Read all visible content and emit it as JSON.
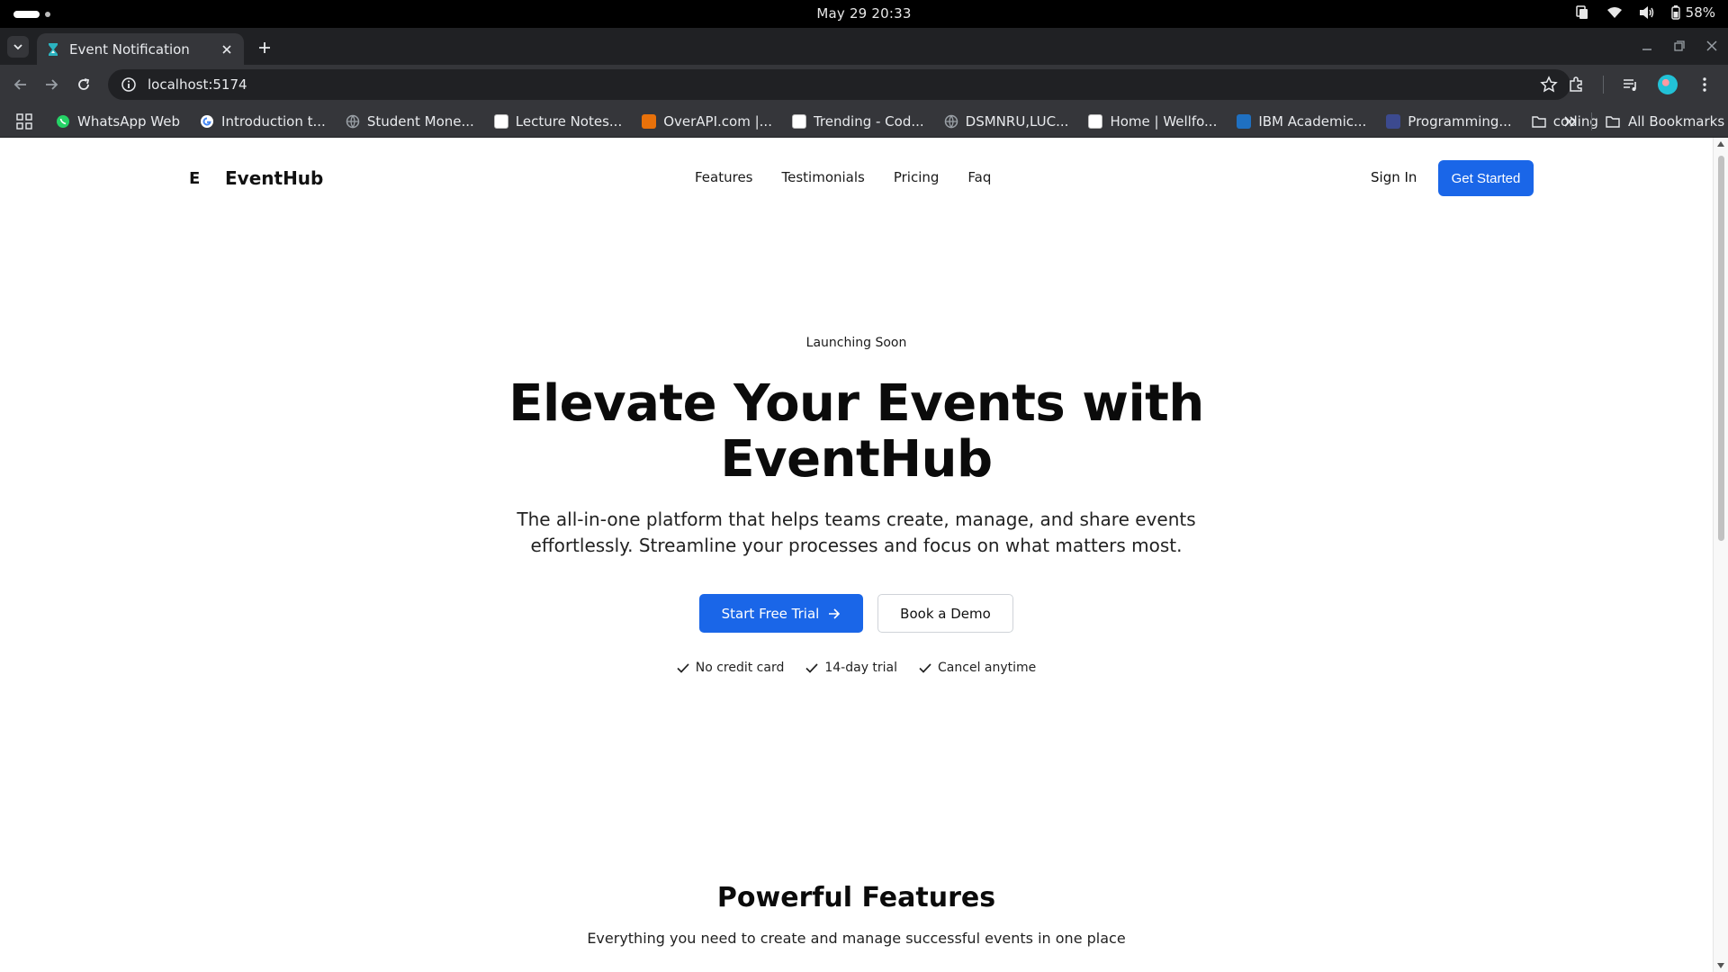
{
  "os": {
    "clock": "May 29  20:33",
    "battery": "58%"
  },
  "browser": {
    "tab_title": "Event Notification",
    "url": "localhost:5174",
    "bookmarks": [
      {
        "label": "WhatsApp Web",
        "icon": "whatsapp-icon",
        "color": "#25d366"
      },
      {
        "label": "Introduction t...",
        "icon": "google-icon",
        "color": "#ffffff"
      },
      {
        "label": "Student Mone...",
        "icon": "globe-icon",
        "color": "#9aa0a6"
      },
      {
        "label": "Lecture Notes...",
        "icon": "notes-icon",
        "color": "#ffffff"
      },
      {
        "label": "OverAPI.com |...",
        "icon": "overapi-icon",
        "color": "#e8710a"
      },
      {
        "label": "Trending - Cod...",
        "icon": "codepen-icon",
        "color": "#ffffff"
      },
      {
        "label": "DSMNRU,LUC...",
        "icon": "globe-icon",
        "color": "#9aa0a6"
      },
      {
        "label": "Home | Wellfo...",
        "icon": "wellfound-icon",
        "color": "#ffffff"
      },
      {
        "label": "IBM Academic...",
        "icon": "ibm-icon",
        "color": "#1f70c1"
      },
      {
        "label": "Programming...",
        "icon": "programming-icon",
        "color": "#3c4a8f"
      },
      {
        "label": "coding",
        "icon": "folder-icon",
        "color": "#e8eaed"
      }
    ],
    "all_bookmarks": "All Bookmarks"
  },
  "site": {
    "brand_mark": "E",
    "brand_name": "EventHub",
    "nav": [
      "Features",
      "Testimonials",
      "Pricing",
      "Faq"
    ],
    "sign_in": "Sign In",
    "get_started": "Get Started"
  },
  "hero": {
    "badge": "Launching Soon",
    "title_line1": "Elevate Your Events with",
    "title_line2": "EventHub",
    "subtitle": "The all-in-one platform that helps teams create, manage, and share events effortlessly. Streamline your processes and focus on what matters most.",
    "primary_cta": "Start Free Trial",
    "secondary_cta": "Book a Demo",
    "checks": [
      "No credit card",
      "14-day trial",
      "Cancel anytime"
    ]
  },
  "features": {
    "title": "Powerful Features",
    "subtitle": "Everything you need to create and manage successful events in one place"
  },
  "colors": {
    "accent": "#1a66e8",
    "os_bar": "#000000",
    "chrome_dark": "#202124",
    "chrome": "#35363a"
  }
}
